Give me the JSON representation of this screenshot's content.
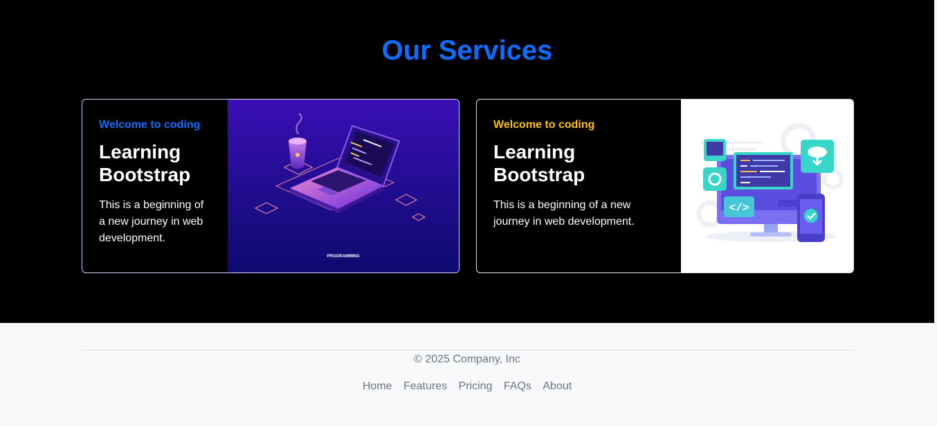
{
  "section": {
    "title": "Our Services"
  },
  "cards": [
    {
      "kicker": "Welcome to coding",
      "title": "Learning Bootstrap",
      "text": "This is a beginning of a new journey in web development.",
      "image": {
        "icon": "laptop-programming-illustration",
        "caption": "PROGRAMMING"
      }
    },
    {
      "kicker": "Welcome to coding",
      "title": "Learning Bootstrap",
      "text": "This is a beginning of a new journey in web development.",
      "image": {
        "icon": "web-development-devices-illustration"
      }
    }
  ],
  "footer": {
    "copyright": "© 2025 Company, Inc",
    "links": [
      "Home",
      "Features",
      "Pricing",
      "FAQs",
      "About"
    ]
  },
  "colors": {
    "accent": "#0d6efd",
    "warning": "#ffc107",
    "dark": "#000000",
    "footer_bg": "#f8f9fa"
  }
}
